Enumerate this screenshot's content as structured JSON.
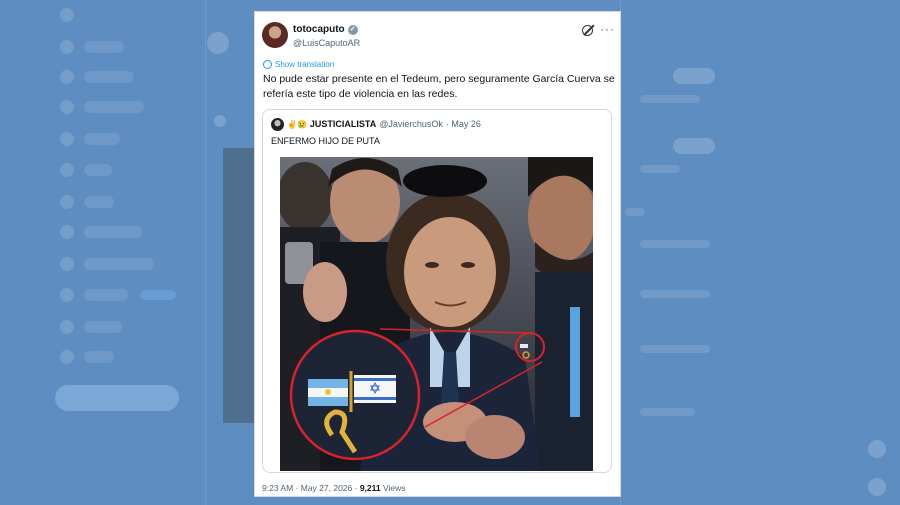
{
  "tweet": {
    "author_name": "totocaputo",
    "author_handle": "@LuisCaputoAR",
    "show_translation": "Show translation",
    "text": "No pude estar presente en el Tedeum, pero seguramente García Cuerva se refería este tipo de violencia en las redes.",
    "time": "9:23 AM · May 27, 2026 · ",
    "views_count": "9,211",
    "views_label": " Views"
  },
  "quote": {
    "emojis": "✌️😢",
    "author_name": "JUSTICIALISTA",
    "author_handle": "@JavierchusOk",
    "date": "· May 26",
    "text": "ENFERMO HIJO DE PUTA"
  },
  "image": {
    "flags": [
      "argentina-flag",
      "israel-flag"
    ]
  },
  "colors": {
    "background": "#5e8dc2",
    "accent": "#1d9bf0",
    "highlight_circle": "#d8232a"
  }
}
